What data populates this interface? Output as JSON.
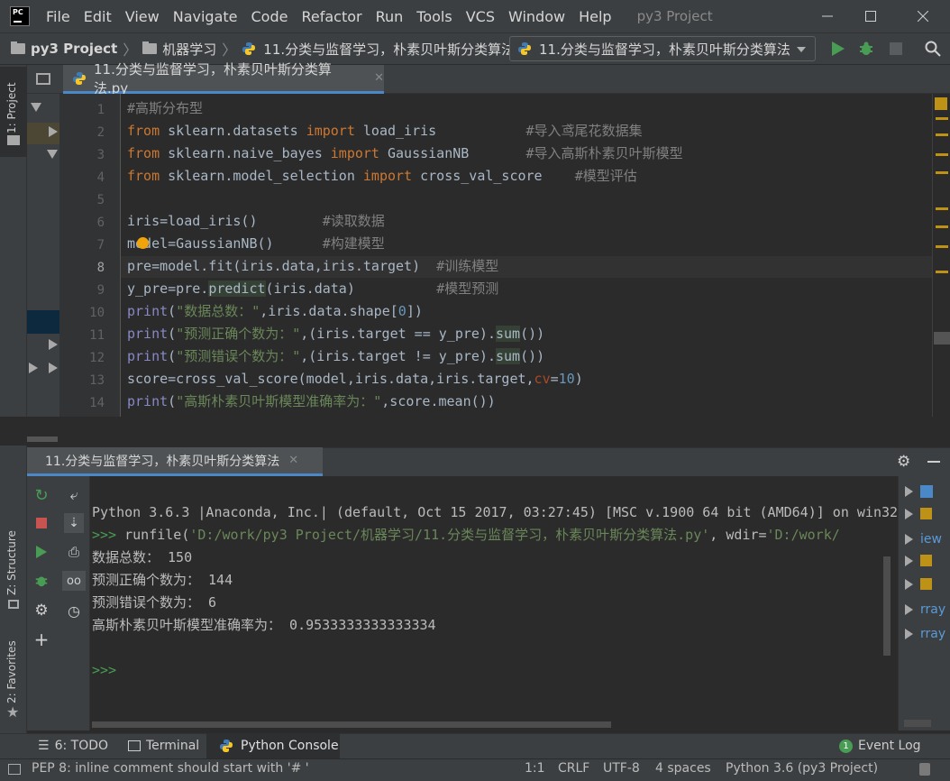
{
  "menu": {
    "items": [
      "File",
      "Edit",
      "View",
      "Navigate",
      "Code",
      "Refactor",
      "Run",
      "Tools",
      "VCS",
      "Window",
      "Help"
    ],
    "window_title": "py3 Project"
  },
  "breadcrumb": {
    "project": "py3 Project",
    "folder": "机器学习",
    "file": "11.分类与监督学习，朴素贝叶斯分类算法.p"
  },
  "run_config": {
    "label": "11.分类与监督学习，朴素贝叶斯分类算法"
  },
  "left_strip": {
    "project_tab": "1: Project",
    "structure_tab": "Z: Structure",
    "favorites_tab": "2: Favorites"
  },
  "editor": {
    "tab_label": "11.分类与监督学习，朴素贝叶斯分类算法.py",
    "line_numbers": [
      "1",
      "2",
      "3",
      "4",
      "5",
      "6",
      "7",
      "8",
      "9",
      "10",
      "11",
      "12",
      "13",
      "14"
    ],
    "code": {
      "l1": "#高斯分布型",
      "l2_kw1": "from",
      "l2_a": " sklearn.datasets ",
      "l2_kw2": "import",
      "l2_b": " load_iris           ",
      "l2_cm": "#导入鸢尾花数据集",
      "l3_kw1": "from",
      "l3_a": " sklearn.naive_bayes ",
      "l3_kw2": "import",
      "l3_b": " GaussianNB       ",
      "l3_cm": "#导入高斯朴素贝叶斯模型",
      "l4_kw1": "from",
      "l4_a": " sklearn.model_selection ",
      "l4_kw2": "import",
      "l4_b": " cross_val_score    ",
      "l4_cm": "#模型评估",
      "l6_a": "iris=load_iris()        ",
      "l6_cm": "#读取数据",
      "l7_a": "model=GaussianNB()      ",
      "l7_cm": "#构建模型",
      "l8_a": "pre=model.fit(iris.data,iris.target)  ",
      "l8_cm": "#训练模型",
      "l9_a": "y_pre=pre.",
      "l9_hl": "predict",
      "l9_b": "(iris.data)          ",
      "l9_cm": "#模型预测",
      "l10_fn": "print",
      "l10_a": "(",
      "l10_st": "\"数据总数：\"",
      "l10_b": ",iris.data.shape[",
      "l10_nm": "0",
      "l10_c": "])",
      "l11_fn": "print",
      "l11_a": "(",
      "l11_st": "\"预测正确个数为：\"",
      "l11_b": ",(iris.target == y_pre).",
      "l11_hl": "sum",
      "l11_c": "())",
      "l12_fn": "print",
      "l12_a": "(",
      "l12_st": "\"预测错误个数为：\"",
      "l12_b": ",(iris.target != y_pre).",
      "l12_hl": "sum",
      "l12_c": "())",
      "l13_a": "score=cross_val_score(model,iris.data,iris.target,",
      "l13_pm": "cv",
      "l13_b": "=",
      "l13_nm": "10",
      "l13_c": ")",
      "l14_fn": "print",
      "l14_a": "(",
      "l14_st": "\"高斯朴素贝叶斯模型准确率为：\"",
      "l14_b": ",score.mean())"
    }
  },
  "console": {
    "tab_label": "11.分类与监督学习，朴素贝叶斯分类算法",
    "lines": {
      "banner": "Python 3.6.3 |Anaconda, Inc.| (default, Oct 15 2017, 03:27:45) [MSC v.1900 64 bit (AMD64)] on win32",
      "prompt": ">>>",
      "runfile_a": " runfile(",
      "runfile_st": "'D:/work/py3 Project/机器学习/11.分类与监督学习，朴素贝叶斯分类算法.py'",
      "runfile_b": ", wdir=",
      "runfile_st2": "'D:/work/",
      "out1": "数据总数： 150",
      "out2": "预测正确个数为： 144",
      "out3": "预测错误个数为： 6",
      "out4": "高斯朴素贝叶斯模型准确率为： 0.9533333333333334",
      "prompt2": ">>>"
    },
    "vars": [
      "iew",
      "rray",
      "rray"
    ]
  },
  "bottom_tabs": {
    "todo": "6: TODO",
    "terminal": "Terminal",
    "python_console": "Python Console",
    "event_log": "Event Log",
    "event_count": "1"
  },
  "status": {
    "message": "PEP 8: inline comment should start with '# '",
    "position": "1:1",
    "line_sep": "CRLF",
    "encoding": "UTF-8",
    "indent": "4 spaces",
    "interpreter": "Python 3.6 (py3 Project)"
  }
}
